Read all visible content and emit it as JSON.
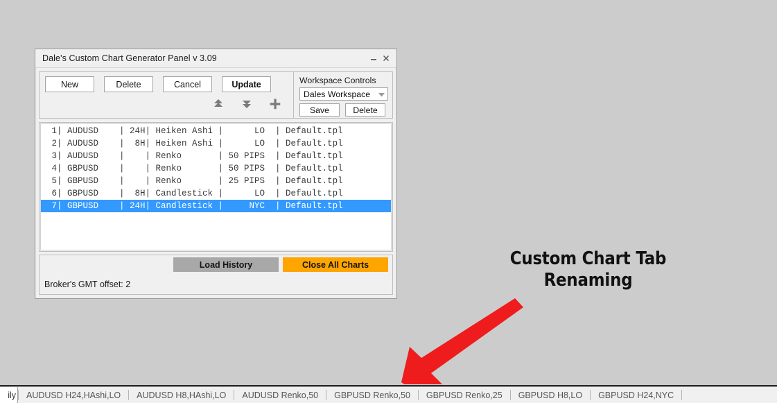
{
  "window": {
    "title": "Dale's Custom Chart Generator Panel v 3.09",
    "minimize_icon": "minimize-icon",
    "close_icon": "close-icon"
  },
  "toolbar": {
    "buttons": [
      {
        "label": "New",
        "bold": false
      },
      {
        "label": "Delete",
        "bold": false
      },
      {
        "label": "Cancel",
        "bold": false
      },
      {
        "label": "Update",
        "bold": true
      }
    ],
    "icons": [
      {
        "name": "move-up-icon"
      },
      {
        "name": "move-down-icon"
      },
      {
        "name": "add-plus-icon"
      }
    ]
  },
  "workspace": {
    "title": "Workspace Controls",
    "selected": "Dales Workspace",
    "dropdown_icon": "chevron-down-icon",
    "save_label": "Save",
    "delete_label": "Delete"
  },
  "list": {
    "rows": [
      {
        "index": "1",
        "symbol": "AUDUSD",
        "timeframe": "24H",
        "type": "Heiken Ashi",
        "param": "LO",
        "template": "Default.tpl",
        "selected": false
      },
      {
        "index": "2",
        "symbol": "AUDUSD",
        "timeframe": "8H",
        "type": "Heiken Ashi",
        "param": "LO",
        "template": "Default.tpl",
        "selected": false
      },
      {
        "index": "3",
        "symbol": "AUDUSD",
        "timeframe": "",
        "type": "Renko",
        "param": "50 PIPS",
        "template": "Default.tpl",
        "selected": false
      },
      {
        "index": "4",
        "symbol": "GBPUSD",
        "timeframe": "",
        "type": "Renko",
        "param": "50 PIPS",
        "template": "Default.tpl",
        "selected": false
      },
      {
        "index": "5",
        "symbol": "GBPUSD",
        "timeframe": "",
        "type": "Renko",
        "param": "25 PIPS",
        "template": "Default.tpl",
        "selected": false
      },
      {
        "index": "6",
        "symbol": "GBPUSD",
        "timeframe": "8H",
        "type": "Candlestick",
        "param": "LO",
        "template": "Default.tpl",
        "selected": false
      },
      {
        "index": "7",
        "symbol": "GBPUSD",
        "timeframe": "24H",
        "type": "Candlestick",
        "param": "NYC",
        "template": "Default.tpl",
        "selected": true
      }
    ]
  },
  "bottom": {
    "load_history_label": "Load History",
    "close_all_label": "Close All Charts",
    "gmt_offset_text": "Broker's GMT offset: 2"
  },
  "annotation": {
    "line1": "Custom Chart Tab",
    "line2": "Renaming",
    "arrow_color": "#ee1c1c",
    "arrow_icon": "arrow-down-left-icon"
  },
  "tabbar": {
    "active_tab_label": "ily",
    "tabs": [
      {
        "label": "AUDUSD H24,HAshi,LO"
      },
      {
        "label": "AUDUSD H8,HAshi,LO"
      },
      {
        "label": "AUDUSD Renko,50"
      },
      {
        "label": "GBPUSD Renko,50"
      },
      {
        "label": "GBPUSD Renko,25"
      },
      {
        "label": "GBPUSD H8,LO"
      },
      {
        "label": "GBPUSD H24,NYC"
      }
    ]
  },
  "colors": {
    "background": "#cccccc",
    "selection": "#3399ff",
    "accent_orange": "#ffa500",
    "load_history_gray": "#a8a8a8"
  }
}
